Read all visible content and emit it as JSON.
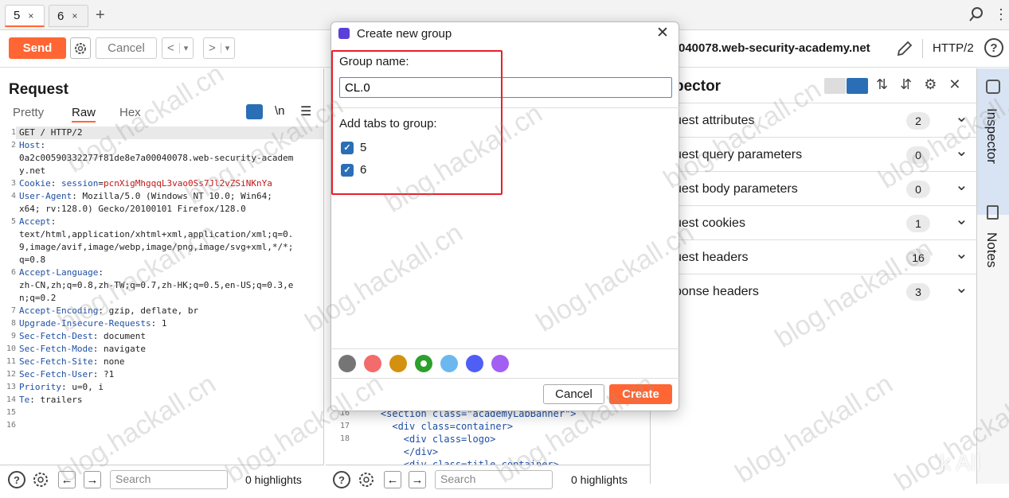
{
  "tabs": [
    {
      "label": "5",
      "close": "×"
    },
    {
      "label": "6",
      "close": "×"
    }
  ],
  "new_tab": "+",
  "toolbar": {
    "send": "Send",
    "cancel": "Cancel",
    "back": "<",
    "forward": ">",
    "dropdown": "▾",
    "target": "040078.web-security-academy.net",
    "protocol": "HTTP/2",
    "help": "?"
  },
  "request": {
    "title": "Request",
    "view_tabs": [
      "Pretty",
      "Raw",
      "Hex"
    ],
    "newline_toggle": "\\n",
    "menu": "☰",
    "lines": [
      {
        "n": "1",
        "t": "GET / HTTP/2"
      },
      {
        "n": "2",
        "k": "Host",
        "t": ":"
      },
      {
        "n": "",
        "t": "0a2c00590332277f81de8e7a00040078.web-security-academ"
      },
      {
        "n": "",
        "t": "y.net"
      },
      {
        "n": "3",
        "k": "Cookie",
        "t": ": ",
        "k2": "session",
        "t2": "=",
        "v": "pcnXigMhgqqL3vao0Ss7Jl2vZSiNKnYa"
      },
      {
        "n": "4",
        "k": "User-Agent",
        "t": ": Mozilla/5.0 (Windows NT 10.0; Win64;"
      },
      {
        "n": "",
        "t": "x64; rv:128.0) Gecko/20100101 Firefox/128.0"
      },
      {
        "n": "5",
        "k": "Accept",
        "t": ":"
      },
      {
        "n": "",
        "t": "text/html,application/xhtml+xml,application/xml;q=0."
      },
      {
        "n": "",
        "t": "9,image/avif,image/webp,image/png,image/svg+xml,*/*;"
      },
      {
        "n": "",
        "t": "q=0.8"
      },
      {
        "n": "6",
        "k": "Accept-Language",
        "t": ":"
      },
      {
        "n": "",
        "t": "zh-CN,zh;q=0.8,zh-TW;q=0.7,zh-HK;q=0.5,en-US;q=0.3,e"
      },
      {
        "n": "",
        "t": "n;q=0.2"
      },
      {
        "n": "7",
        "k": "Accept-Encoding",
        "t": ": gzip, deflate, br"
      },
      {
        "n": "8",
        "k": "Upgrade-Insecure-Requests",
        "t": ": 1"
      },
      {
        "n": "9",
        "k": "Sec-Fetch-Dest",
        "t": ": document"
      },
      {
        "n": "10",
        "k": "Sec-Fetch-Mode",
        "t": ": navigate"
      },
      {
        "n": "11",
        "k": "Sec-Fetch-Site",
        "t": ": none"
      },
      {
        "n": "12",
        "k": "Sec-Fetch-User",
        "t": ": ?1"
      },
      {
        "n": "13",
        "k": "Priority",
        "t": ": u=0, i"
      },
      {
        "n": "14",
        "k": "Te",
        "t": ": trailers"
      },
      {
        "n": "15",
        "t": ""
      },
      {
        "n": "16",
        "t": ""
      }
    ]
  },
  "response": {
    "lines": [
      {
        "n": "16",
        "t": "    <section class=\"academyLabBanner\">"
      },
      {
        "n": "17",
        "t": "      <div class=container>"
      },
      {
        "n": "18",
        "t": "        <div class=logo>"
      },
      {
        "n": "",
        "t": "        </div>"
      },
      {
        "n": "",
        "t": "        <div class=title-container>"
      }
    ]
  },
  "bottom": {
    "search_placeholder": "Search",
    "highlights": "0 highlights"
  },
  "inspector": {
    "title": "pector",
    "rows": [
      {
        "label": "uest attributes",
        "count": "2"
      },
      {
        "label": "uest query parameters",
        "count": "0"
      },
      {
        "label": "uest body parameters",
        "count": "0"
      },
      {
        "label": "uest cookies",
        "count": "1"
      },
      {
        "label": "uest headers",
        "count": "16"
      },
      {
        "label": "ponse headers",
        "count": "3"
      }
    ]
  },
  "side_tabs": {
    "inspector": "Inspector",
    "notes": "Notes"
  },
  "modal": {
    "title": "Create new group",
    "close": "✕",
    "group_name_label": "Group name:",
    "group_name_value": "CL.0",
    "add_tabs_label": "Add tabs to group:",
    "tab_options": [
      {
        "label": "5",
        "checked": true
      },
      {
        "label": "6",
        "checked": true
      }
    ],
    "colors": [
      "#757575",
      "#f36b6b",
      "#d4900f",
      "#2ba02b",
      "#6cb8ee",
      "#4f5ff5",
      "#a35ff2"
    ],
    "selected_color_index": 3,
    "cancel": "Cancel",
    "create": "Create"
  },
  "watermark": "blog.hackall.cn",
  "corner_text": "k All"
}
